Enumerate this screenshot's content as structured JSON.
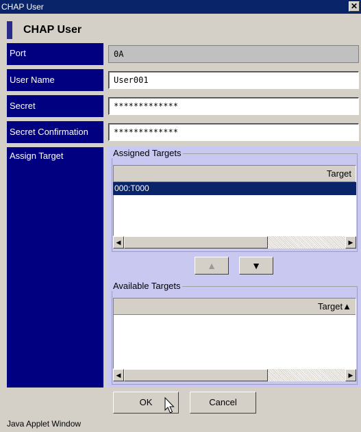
{
  "window": {
    "title": "CHAP User",
    "close_glyph": "✕"
  },
  "header": {
    "title": "CHAP User"
  },
  "form": {
    "port": {
      "label": "Port",
      "value": "0A"
    },
    "user_name": {
      "label": "User Name",
      "value": "User001"
    },
    "secret": {
      "label": "Secret",
      "value": "*************"
    },
    "secret_confirmation": {
      "label": "Secret Confirmation",
      "value": "*************"
    },
    "assign_target": {
      "label": "Assign Target"
    }
  },
  "assigned_targets": {
    "legend": "Assigned Targets",
    "column_header": "Target",
    "rows": [
      "000:T000"
    ],
    "selected_row": 0
  },
  "move_buttons": {
    "up": "▲",
    "down": "▼"
  },
  "available_targets": {
    "legend": "Available Targets",
    "column_header": "Target▲",
    "rows": []
  },
  "footer": {
    "ok_label": "OK",
    "cancel_label": "Cancel"
  },
  "status_text": "Java Applet Window",
  "colors": {
    "label_bg": "#000080",
    "panel_bg": "#c8c8f0",
    "titlebar_bg": "#0a246a",
    "window_bg": "#d4d0c8"
  }
}
